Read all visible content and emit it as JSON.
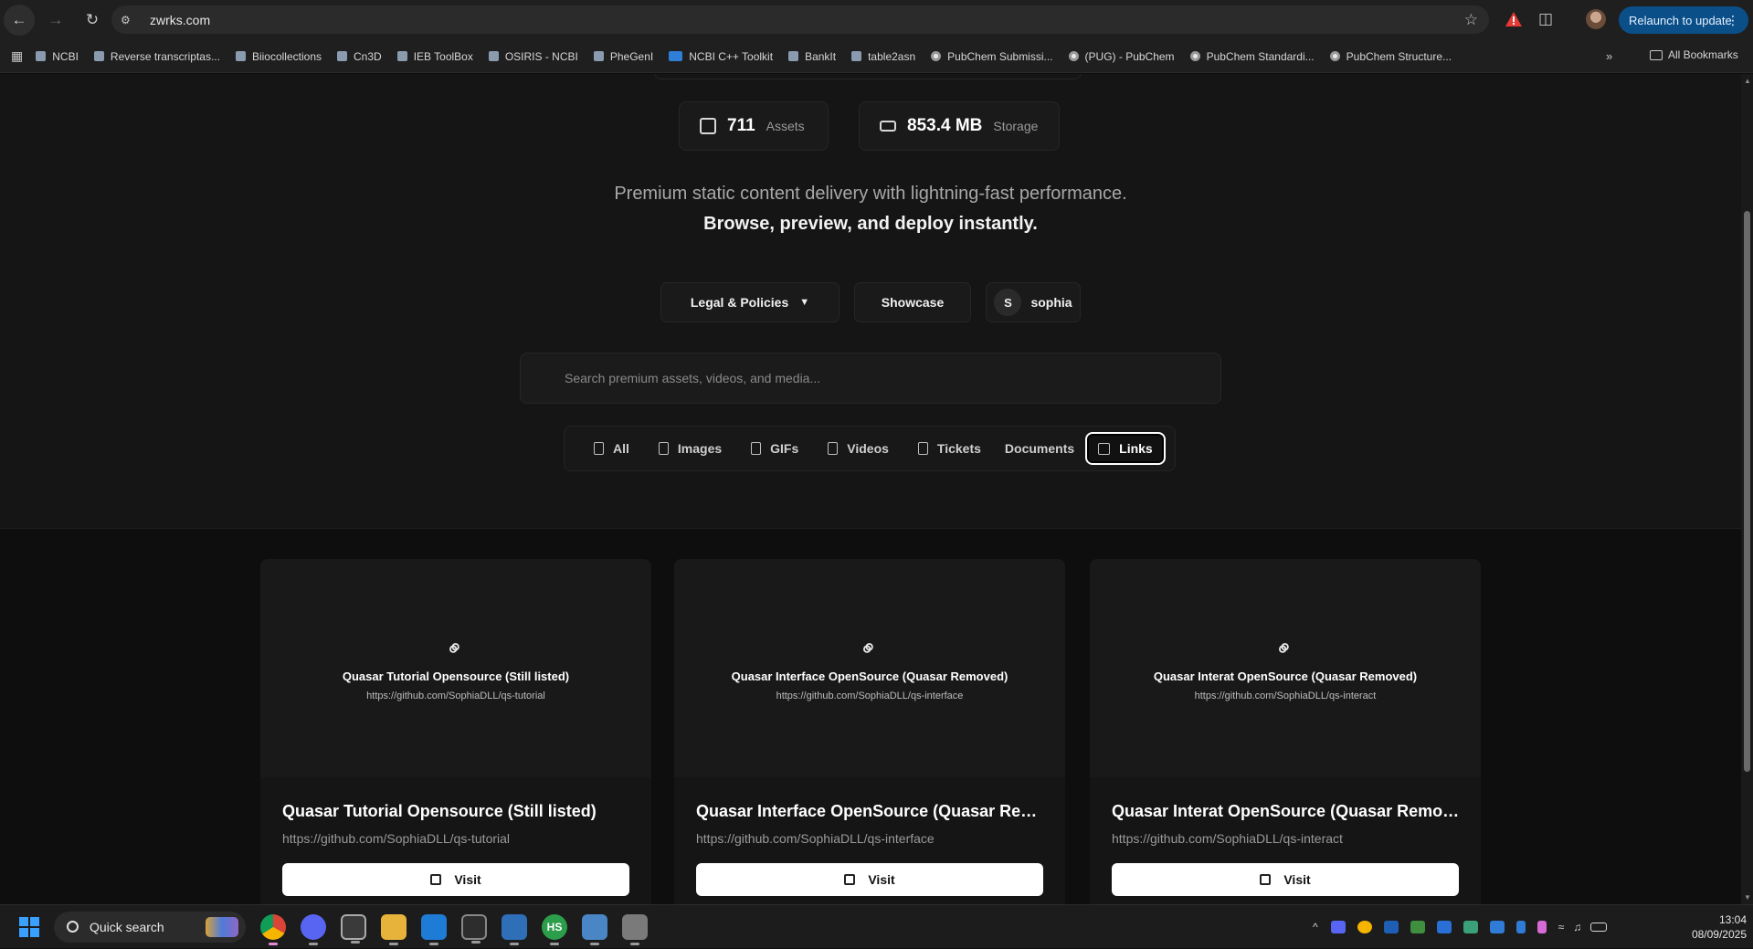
{
  "browser": {
    "url": "zwrks.com",
    "relaunch_label": "Relaunch to update",
    "bookmarks": [
      "NCBI",
      "Reverse transcriptas...",
      "Biiocollections",
      "Cn3D",
      "IEB ToolBox",
      "OSIRIS - NCBI",
      "PheGenI",
      "NCBI C++ Toolkit",
      "BankIt",
      "table2asn",
      "PubChem Submissi...",
      "(PUG) - PubChem",
      "PubChem Standardi...",
      "PubChem Structure..."
    ],
    "all_bookmarks_label": "All Bookmarks"
  },
  "stats": [
    {
      "value": "711",
      "label": "Assets",
      "icon": "image-icon"
    },
    {
      "value": "853.4 MB",
      "label": "Storage",
      "icon": "drive-icon"
    }
  ],
  "tagline": {
    "line1": "Premium static content delivery with lightning-fast performance.",
    "line2": "Browse, preview, and deploy instantly."
  },
  "nav": {
    "legal_label": "Legal & Policies",
    "showcase_label": "Showcase",
    "user_initial": "S",
    "user_name": "sophia"
  },
  "search": {
    "placeholder": "Search premium assets, videos, and media..."
  },
  "filters": {
    "all": "All",
    "images": "Images",
    "gifs": "GIFs",
    "videos": "Videos",
    "tickets": "Tickets",
    "documents": "Documents",
    "links": "Links",
    "active": "Links"
  },
  "cards": [
    {
      "title": "Quasar Tutorial Opensource (Still listed)",
      "url": "https://github.com/SophiaDLL/qs-tutorial",
      "visit_label": "Visit"
    },
    {
      "title": "Quasar Interface OpenSource (Quasar Removed)",
      "title_truncated": "Quasar Interface OpenSource (Quasar Remo...",
      "url": "https://github.com/SophiaDLL/qs-interface",
      "visit_label": "Visit"
    },
    {
      "title": "Quasar Interat OpenSource (Quasar Removed)",
      "url": "https://github.com/SophiaDLL/qs-interact",
      "visit_label": "Visit"
    }
  ],
  "taskbar": {
    "search_label": "Quick search",
    "time": "13:04",
    "date": "08/09/2025"
  },
  "colors": {
    "accent": "#0b4f89",
    "background": "#0e0e0e",
    "card": "#151515",
    "button": "#ffffff"
  }
}
